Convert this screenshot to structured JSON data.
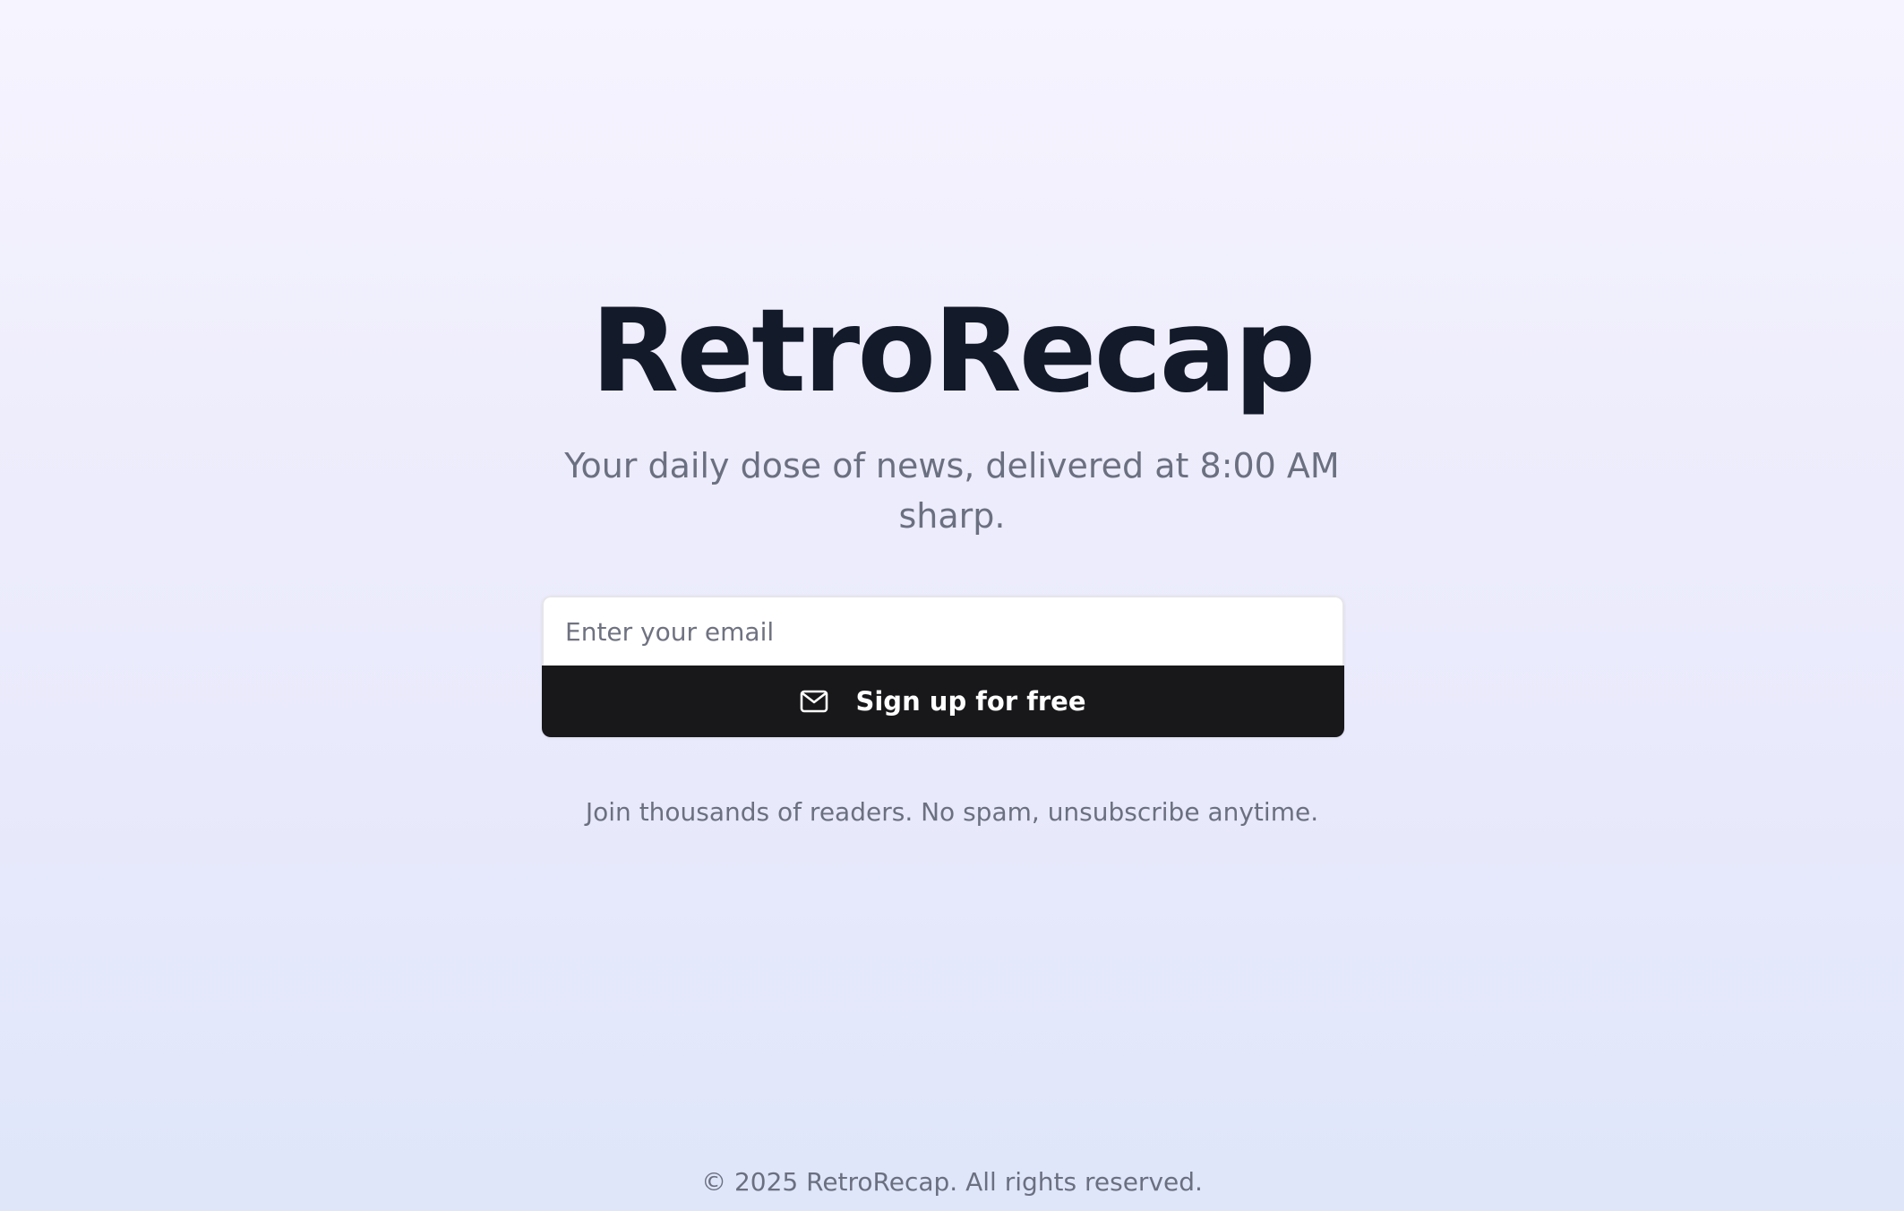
{
  "hero": {
    "title": "RetroRecap",
    "subtitle": "Your daily dose of news, delivered at 8:00 AM sharp."
  },
  "signup": {
    "email_placeholder": "Enter your email",
    "button_label": "Sign up for free",
    "button_icon": "mail-icon",
    "note": "Join thousands of readers. No spam, unsubscribe anytime."
  },
  "footer": {
    "copyright": "© 2025 RetroRecap. All rights reserved."
  },
  "colors": {
    "title": "#131a2a",
    "muted_text": "#6b7080",
    "button_bg": "#18181b",
    "button_text": "#ffffff",
    "background_top": "#f6f4fe",
    "background_bottom": "#dfe6fa"
  }
}
